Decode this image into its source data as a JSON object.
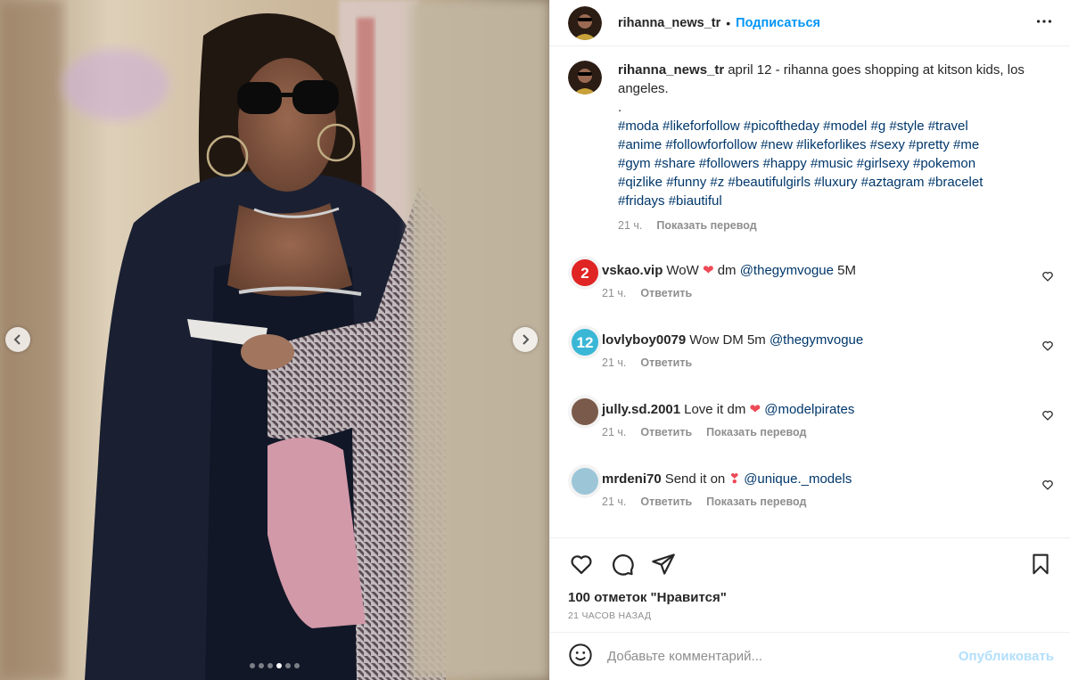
{
  "post": {
    "author": "rihanna_news_tr",
    "header_separator": "•",
    "follow_label": "Подписаться",
    "caption": "april 12 - rihanna goes shopping at kitson kids, los angeles.",
    "caption_dot": ".",
    "hashtags_line1": "#moda #likeforfollow #picoftheday #model #g #style #travel",
    "hashtags_line2": "#anime #followforfollow #new #likeforlikes #sexy #pretty #me",
    "hashtags_line3": "#gym #share #followers #happy #music #girlsexy #pokemon",
    "hashtags_line4": "#qizlike #funny #z #beautifulgirls #luxury #aztagram #bracelet",
    "hashtags_line5": "#fridays #biautiful",
    "caption_time": "21 ч.",
    "translate_label": "Показать перевод",
    "likes_text": "100 отметок \"Нравится\"",
    "time_ago": "21 часов назад",
    "carousel": {
      "total": 6,
      "active": 3
    }
  },
  "comments": [
    {
      "user": "vskao.vip",
      "text_before": "WoW",
      "emoji": "❤",
      "text_after": "dm",
      "mention": "@thegymvogue",
      "text_end": "5M",
      "time": "21 ч.",
      "reply": "Ответить",
      "translate": "",
      "avatar_color": "#e02424",
      "avatar_label": "2"
    },
    {
      "user": "lovlyboy0079",
      "text_before": "Wow DM 5m",
      "emoji": "",
      "text_after": "",
      "mention": "@thegymvogue",
      "text_end": "",
      "time": "21 ч.",
      "reply": "Ответить",
      "translate": "",
      "avatar_color": "#3bb7d6",
      "avatar_label": "12"
    },
    {
      "user": "jully.sd.2001",
      "text_before": "Love it dm",
      "emoji": "❤",
      "text_after": "",
      "mention": "@modelpirates",
      "text_end": "",
      "time": "21 ч.",
      "reply": "Ответить",
      "translate": "Показать перевод",
      "avatar_color": "#7a5a4a",
      "avatar_label": ""
    },
    {
      "user": "mrdeni70",
      "text_before": "Send it on",
      "emoji": "❣",
      "text_after": "",
      "mention": "@unique._models",
      "text_end": "",
      "time": "21 ч.",
      "reply": "Ответить",
      "translate": "Показать перевод",
      "avatar_color": "#9cc6d8",
      "avatar_label": ""
    }
  ],
  "comment_box": {
    "placeholder": "Добавьте комментарий...",
    "publish_label": "Опубликовать"
  },
  "icons": {
    "prev": "chevron-left-icon",
    "next": "chevron-right-icon",
    "more": "more-horizontal-icon",
    "like": "heart-icon",
    "comment": "comment-bubble-icon",
    "share": "paper-plane-icon",
    "save": "bookmark-icon",
    "emoji": "smiley-icon"
  },
  "colors": {
    "link": "#00376b",
    "follow": "#0095f6",
    "publish_disabled": "#b2dffc",
    "heart": "#ed4956"
  }
}
